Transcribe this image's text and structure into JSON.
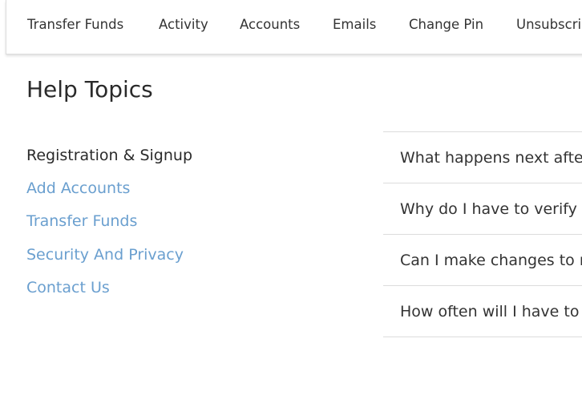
{
  "nav": {
    "items": [
      {
        "label": "Transfer Funds"
      },
      {
        "label": "Activity"
      },
      {
        "label": "Accounts"
      },
      {
        "label": "Emails"
      },
      {
        "label": "Change Pin"
      },
      {
        "label": "Unsubscri"
      }
    ]
  },
  "page": {
    "title": "Help Topics"
  },
  "topics": [
    {
      "label": "Registration & Signup"
    },
    {
      "label": "Add Accounts"
    },
    {
      "label": "Transfer Funds"
    },
    {
      "label": "Security And Privacy"
    },
    {
      "label": "Contact Us"
    }
  ],
  "faq": [
    {
      "question": "What happens next after"
    },
    {
      "question": "Why do I have to verify m"
    },
    {
      "question": "Can I make changes to m"
    },
    {
      "question": "How often will I have to v"
    }
  ],
  "colors": {
    "link": "#6a9fcf",
    "text": "#333333",
    "divider": "#dcdcdc"
  }
}
